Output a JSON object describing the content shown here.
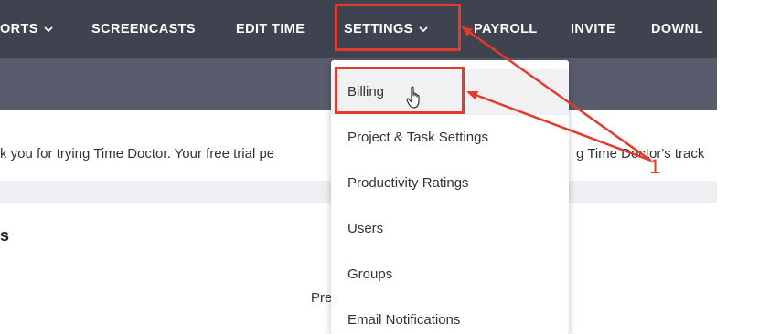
{
  "nav": {
    "items": [
      {
        "label": "ORTS",
        "chevron": true
      },
      {
        "label": "SCREENCASTS",
        "chevron": false
      },
      {
        "label": "EDIT TIME",
        "chevron": false
      },
      {
        "label": "SETTINGS",
        "chevron": true
      },
      {
        "label": "PAYROLL",
        "chevron": false
      },
      {
        "label": "INVITE",
        "chevron": false
      },
      {
        "label": "DOWNL",
        "chevron": false
      }
    ]
  },
  "banner": {
    "text": "k you for trying Time Doctor. Your free trial pe",
    "text_right": "g Time Doctor's track"
  },
  "page": {
    "heading": "s",
    "partial_text": "Pre"
  },
  "dropdown": {
    "items": [
      "Billing",
      "Project & Task Settings",
      "Productivity Ratings",
      "Users",
      "Groups",
      "Email Notifications"
    ]
  },
  "annotation": {
    "label": "1"
  },
  "colors": {
    "nav_bg": "#3f4350",
    "subnav_bg": "#595c6c",
    "highlight": "#e23b2c"
  },
  "icons": {
    "cursor": "hand-pointer-icon",
    "chevron": "chevron-down-icon"
  }
}
